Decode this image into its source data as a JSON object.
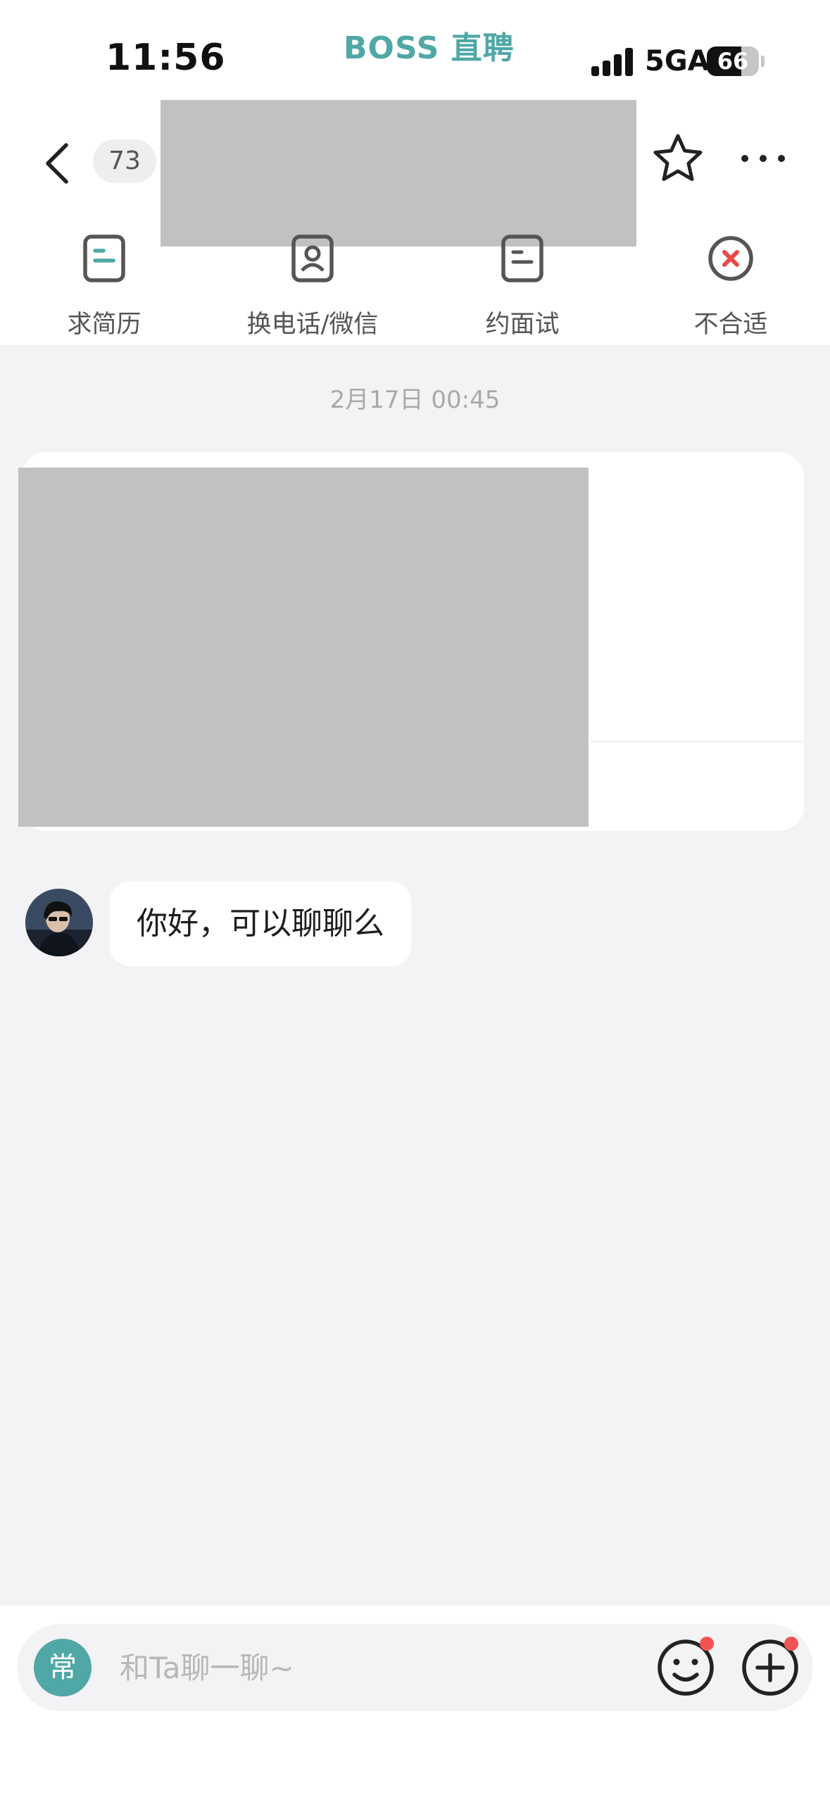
{
  "status_bar": {
    "time": "11:56",
    "app_brand": "BOSS 直聘",
    "network": "5GA",
    "battery_percent": 66
  },
  "header": {
    "unread_count": "73",
    "actions": [
      {
        "label": "求简历",
        "icon": "resume-icon"
      },
      {
        "label": "换电话/微信",
        "icon": "contact-exchange-icon"
      },
      {
        "label": "约面试",
        "icon": "interview-icon"
      },
      {
        "label": "不合适",
        "icon": "reject-icon"
      }
    ]
  },
  "chat": {
    "timestamp": "2月17日 00:45",
    "messages": [
      {
        "sender": "other",
        "text": "你好，可以聊聊么"
      }
    ]
  },
  "input_bar": {
    "phrase_label": "常",
    "placeholder": "和Ta聊一聊~"
  },
  "colors": {
    "accent": "#4fa8a6",
    "reject": "#e64a4a",
    "background": "#f3f3f5",
    "redacted": "#c1c1c1",
    "notification_dot": "#f25454"
  }
}
